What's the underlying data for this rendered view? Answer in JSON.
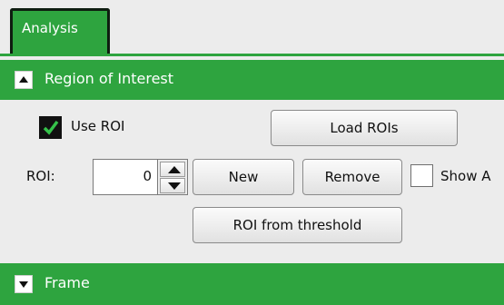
{
  "tabs": [
    {
      "label": "Analysis",
      "active": true
    }
  ],
  "sections": {
    "roi": {
      "title": "Region of Interest",
      "expanded": true
    },
    "frame": {
      "title": "Frame",
      "expanded": false
    }
  },
  "roi_panel": {
    "use_roi": {
      "label": "Use ROI",
      "checked": true
    },
    "load_rois_label": "Load ROIs",
    "roi_label": "ROI:",
    "roi_value": "0",
    "new_label": "New",
    "remove_label": "Remove",
    "show_all": {
      "label": "Show A",
      "checked": false
    },
    "threshold_label": "ROI from threshold"
  },
  "colors": {
    "accent": "#2ea43f",
    "panel_bg": "#ececec"
  }
}
